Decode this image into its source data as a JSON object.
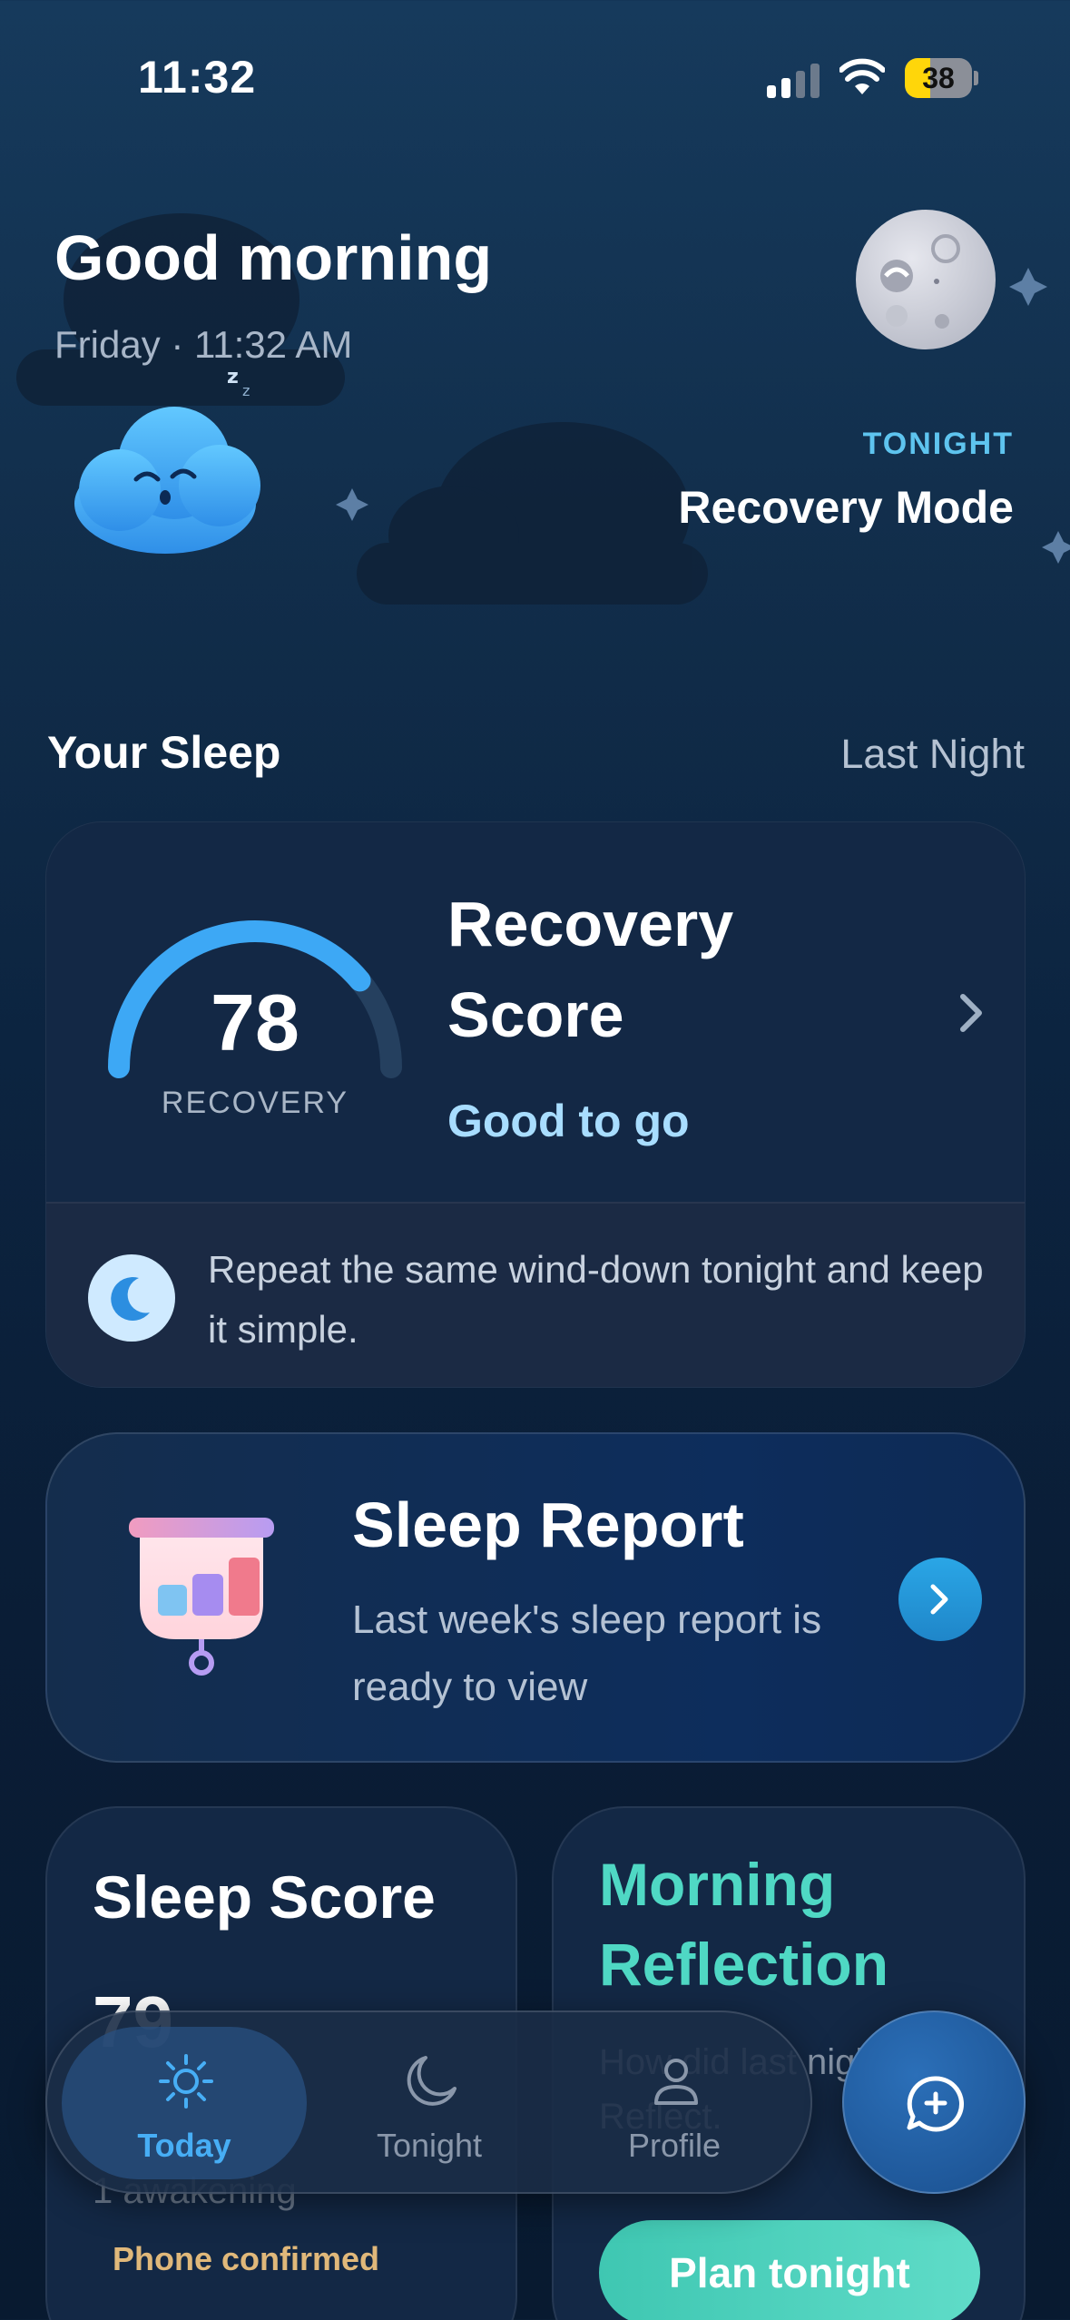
{
  "status_bar": {
    "time": "11:32",
    "battery": "38",
    "battery_level": 0.38
  },
  "header": {
    "greeting": "Good morning",
    "date": "Friday · 11:32 AM",
    "tonight_label": "TONIGHT",
    "tonight_mode": "Recovery Mode"
  },
  "section": {
    "title": "Your Sleep",
    "period": "Last Night"
  },
  "recovery": {
    "score": "78",
    "score_value": 78,
    "gauge_label": "RECOVERY",
    "title": "Recovery Score",
    "status": "Good to go",
    "tip": "Repeat the same wind-down tonight and keep it simple."
  },
  "report": {
    "title": "Sleep Report",
    "subtitle": "Last week's sleep report is ready to view"
  },
  "sleep_score": {
    "title": "Sleep Score",
    "value": "79",
    "awakening": "1 awakening",
    "confirm": "Phone confirmed"
  },
  "reflection": {
    "title": "Morning Reflection",
    "body": "How did last night feel? Reflect.",
    "button": "Plan tonight"
  },
  "tabs": [
    {
      "label": "Today",
      "icon": "sun-icon",
      "active": true
    },
    {
      "label": "Tonight",
      "icon": "moon-icon",
      "active": false
    },
    {
      "label": "Profile",
      "icon": "person-icon",
      "active": false
    }
  ],
  "colors": {
    "accent": "#47aef5",
    "teal": "#4fd8c4",
    "status_good": "#a8ddff",
    "battery": "#ffd60a"
  }
}
